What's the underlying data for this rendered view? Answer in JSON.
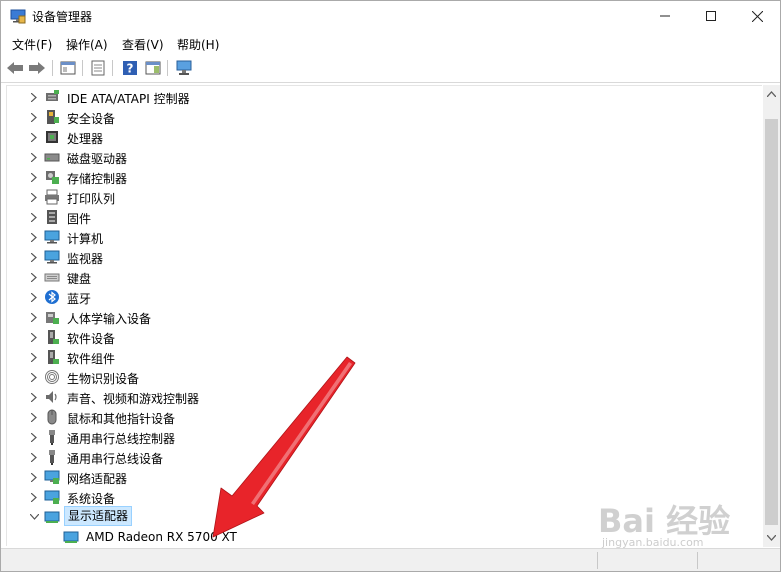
{
  "window": {
    "title": "设备管理器",
    "controls": {
      "minimize": "—",
      "maximize": "☐",
      "close": "✕"
    }
  },
  "menu": [
    "文件(F)",
    "操作(A)",
    "查看(V)",
    "帮助(H)"
  ],
  "tree": {
    "items": [
      {
        "label": "IDE ATA/ATAPI 控制器",
        "icon": "ide-controller-icon",
        "expanded": false
      },
      {
        "label": "安全设备",
        "icon": "security-device-icon",
        "expanded": false
      },
      {
        "label": "处理器",
        "icon": "processor-icon",
        "expanded": false
      },
      {
        "label": "磁盘驱动器",
        "icon": "disk-drive-icon",
        "expanded": false
      },
      {
        "label": "存储控制器",
        "icon": "storage-controller-icon",
        "expanded": false
      },
      {
        "label": "打印队列",
        "icon": "printer-icon",
        "expanded": false
      },
      {
        "label": "固件",
        "icon": "firmware-icon",
        "expanded": false
      },
      {
        "label": "计算机",
        "icon": "computer-icon",
        "expanded": false
      },
      {
        "label": "监视器",
        "icon": "monitor-icon",
        "expanded": false
      },
      {
        "label": "键盘",
        "icon": "keyboard-icon",
        "expanded": false
      },
      {
        "label": "蓝牙",
        "icon": "bluetooth-icon",
        "expanded": false
      },
      {
        "label": "人体学输入设备",
        "icon": "hid-icon",
        "expanded": false
      },
      {
        "label": "软件设备",
        "icon": "software-device-icon",
        "expanded": false
      },
      {
        "label": "软件组件",
        "icon": "software-component-icon",
        "expanded": false
      },
      {
        "label": "生物识别设备",
        "icon": "fingerprint-icon",
        "expanded": false
      },
      {
        "label": "声音、视频和游戏控制器",
        "icon": "speaker-icon",
        "expanded": false
      },
      {
        "label": "鼠标和其他指针设备",
        "icon": "mouse-icon",
        "expanded": false
      },
      {
        "label": "通用串行总线控制器",
        "icon": "usb-controller-icon",
        "expanded": false
      },
      {
        "label": "通用串行总线设备",
        "icon": "usb-device-icon",
        "expanded": false
      },
      {
        "label": "网络适配器",
        "icon": "network-adapter-icon",
        "expanded": false
      },
      {
        "label": "系统设备",
        "icon": "system-device-icon",
        "expanded": false
      },
      {
        "label": "显示适配器",
        "icon": "display-adapter-icon",
        "expanded": true,
        "selected": true
      }
    ],
    "child": {
      "label": "AMD Radeon RX 5700 XT",
      "icon": "display-adapter-icon"
    }
  },
  "watermark": {
    "main": "Bai 经验",
    "sub": "jingyan.baidu.com"
  },
  "colors": {
    "selection": "#cce8ff",
    "arrow": "#e8242a"
  }
}
